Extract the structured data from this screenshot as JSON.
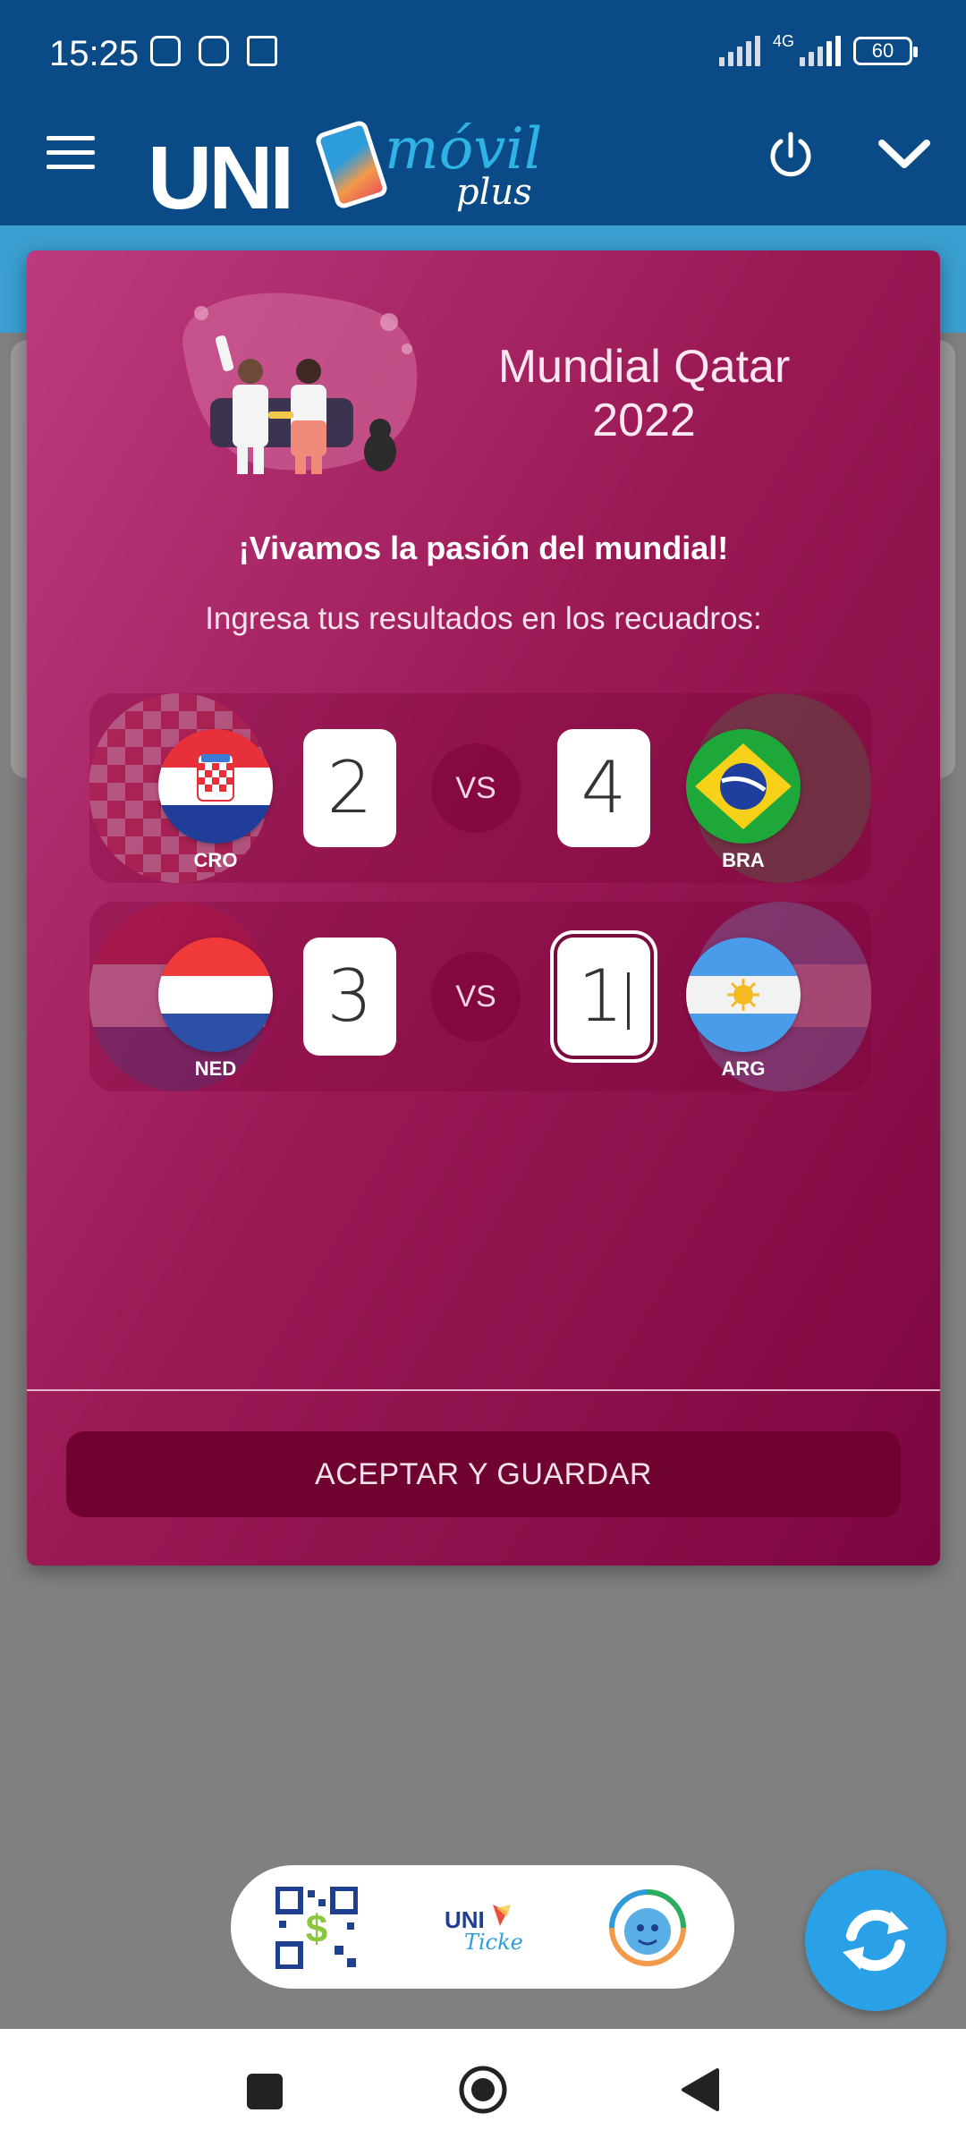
{
  "status_bar": {
    "time": "15:25",
    "network": "4G",
    "battery": "60",
    "icons": [
      "nfc-icon",
      "instagram-icon",
      "robot-icon"
    ]
  },
  "app_header": {
    "logo_main": "UNI",
    "logo_script": "móvil",
    "logo_sub": "plus",
    "menu_icon": "hamburger-menu-icon",
    "power_icon": "power-icon",
    "expand_icon": "chevron-down-icon"
  },
  "modal": {
    "title": "Mundial Qatar 2022",
    "subtitle": "¡Vivamos la pasión del mundial!",
    "instruction": "Ingresa tus resultados en los recuadros:",
    "vs_label": "VS",
    "accept_button": "ACEPTAR Y GUARDAR",
    "matches": [
      {
        "home": {
          "code": "CRO",
          "score": "2"
        },
        "away": {
          "code": "BRA",
          "score": "4"
        }
      },
      {
        "home": {
          "code": "NED",
          "score": "3"
        },
        "away": {
          "code": "ARG",
          "score": "1"
        }
      }
    ]
  },
  "toolbar": {
    "items": [
      "qr-payment-icon",
      "uni-ticket-icon",
      "support-agent-icon"
    ],
    "ticket_logo_text": "UNI",
    "ticket_logo_script": "Ticket",
    "refresh_icon": "refresh-icon"
  },
  "colors": {
    "header": "#0a4b87",
    "modal_start": "#bd3a7e",
    "modal_end": "#7d0640",
    "button": "#70022f",
    "fab": "#2aa1e6"
  }
}
